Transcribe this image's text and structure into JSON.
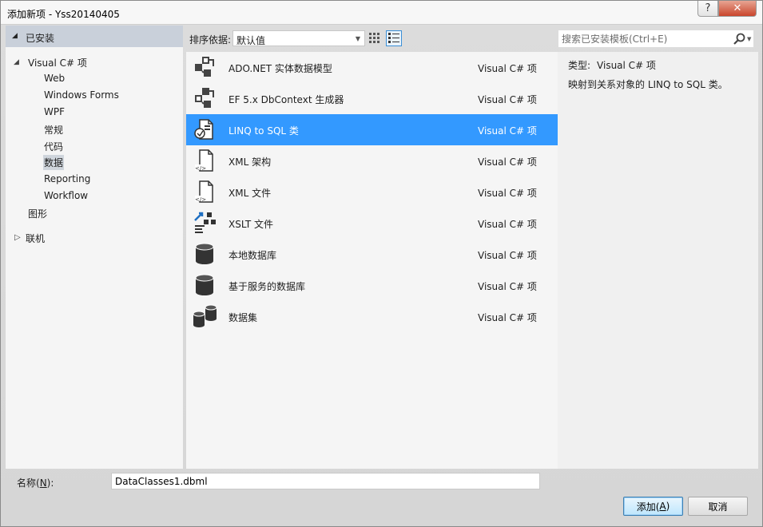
{
  "window": {
    "title": "添加新项 - Yss20140405",
    "help_label": "?",
    "close_label": "✕"
  },
  "sidebar": {
    "installed_label": "已安装",
    "visual_csharp_label": "Visual C# 项",
    "children": [
      "Web",
      "Windows Forms",
      "WPF",
      "常规",
      "代码",
      "数据",
      "Reporting",
      "Workflow"
    ],
    "selected_child": "数据",
    "graphics_label": "图形",
    "online_label": "联机"
  },
  "toolbar": {
    "sort_label": "排序依据:",
    "sort_value": "默认值",
    "view_grid_icon": "grid-view-icon",
    "view_list_icon": "list-view-icon"
  },
  "items": [
    {
      "name": "ADO.NET 实体数据模型",
      "type": "Visual C# 项",
      "icon": "entity-model-icon"
    },
    {
      "name": "EF 5.x DbContext 生成器",
      "type": "Visual C# 项",
      "icon": "dbcontext-generator-icon"
    },
    {
      "name": "LINQ to SQL 类",
      "type": "Visual C# 项",
      "icon": "linq-to-sql-icon",
      "selected": true
    },
    {
      "name": "XML 架构",
      "type": "Visual C# 项",
      "icon": "xml-schema-icon"
    },
    {
      "name": "XML 文件",
      "type": "Visual C# 项",
      "icon": "xml-file-icon"
    },
    {
      "name": "XSLT 文件",
      "type": "Visual C# 项",
      "icon": "xslt-file-icon"
    },
    {
      "name": "本地数据库",
      "type": "Visual C# 项",
      "icon": "local-database-icon"
    },
    {
      "name": "基于服务的数据库",
      "type": "Visual C# 项",
      "icon": "service-database-icon"
    },
    {
      "name": "数据集",
      "type": "Visual C# 项",
      "icon": "dataset-icon"
    }
  ],
  "search": {
    "placeholder": "搜索已安装模板(Ctrl+E)"
  },
  "details": {
    "type_key": "类型:",
    "type_value": "Visual C# 项",
    "description": "映射到关系对象的 LINQ to SQL 类。"
  },
  "form": {
    "name_label_prefix": "名称(",
    "name_label_key": "N",
    "name_label_suffix": "):",
    "name_value": "DataClasses1.dbml"
  },
  "buttons": {
    "add_prefix": "添加(",
    "add_key": "A",
    "add_suffix": ")",
    "cancel": "取消"
  },
  "colors": {
    "selection": "#3399ff",
    "installed_header": "#c9d0da"
  }
}
